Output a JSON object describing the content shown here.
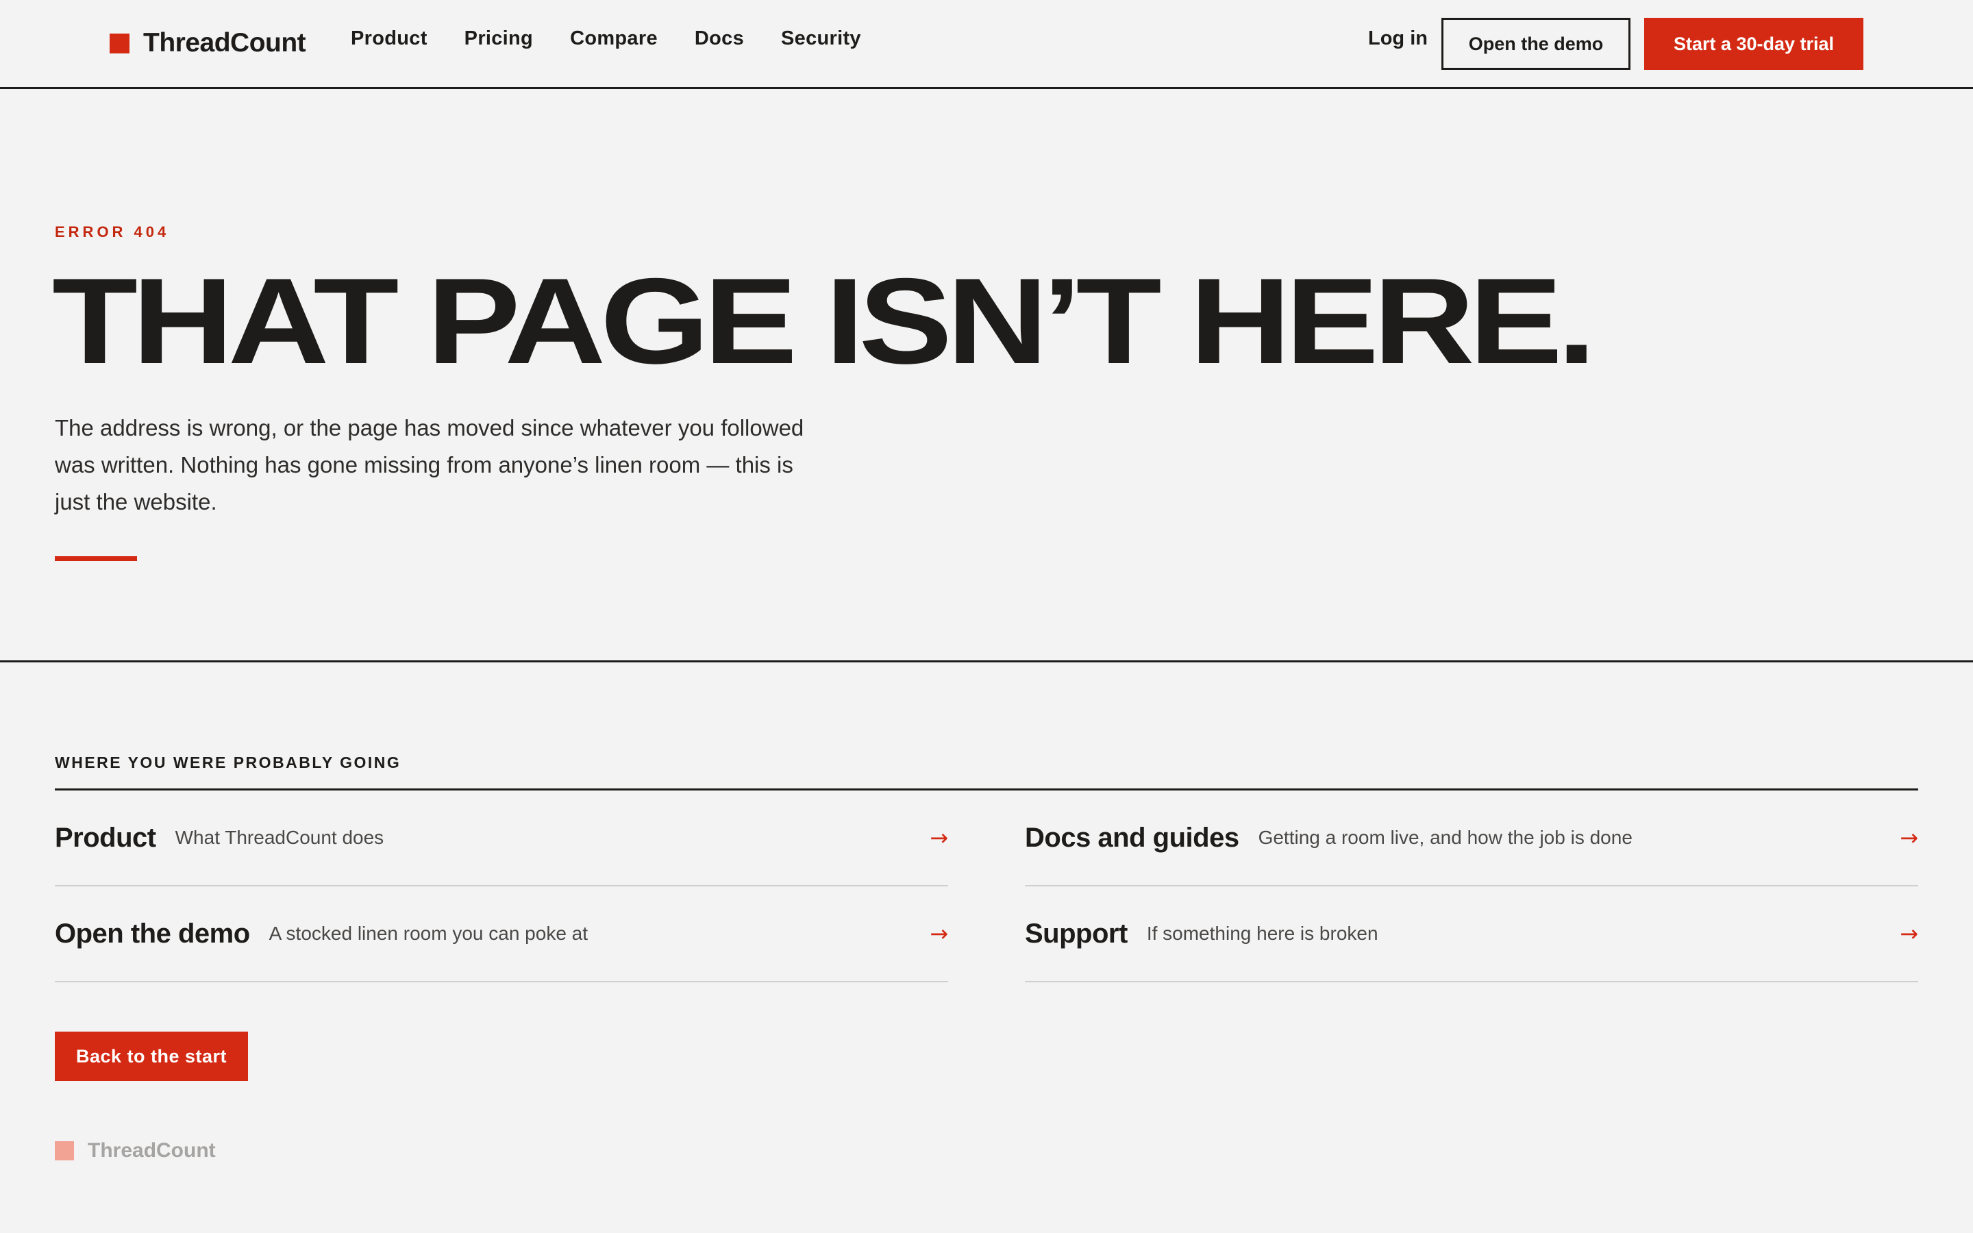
{
  "brand": {
    "name": "ThreadCount",
    "accent_color": "#d42a14"
  },
  "nav": {
    "items": [
      {
        "label": "Product"
      },
      {
        "label": "Pricing"
      },
      {
        "label": "Compare"
      },
      {
        "label": "Docs"
      },
      {
        "label": "Security"
      }
    ],
    "login_label": "Log in",
    "demo_label": "Open the demo",
    "trial_label": "Start a 30-day trial"
  },
  "hero": {
    "eyebrow": "ERROR 404",
    "headline": "THAT PAGE ISN’T HERE.",
    "body": "The address is wrong, or the page has moved since whatever you followed was written. Nothing has gone missing from anyone’s linen room — this is just the website."
  },
  "suggestions": {
    "title": "WHERE YOU WERE PROBABLY GOING",
    "arrow": "→",
    "links": [
      {
        "title": "Product",
        "desc": "What ThreadCount does"
      },
      {
        "title": "Docs and guides",
        "desc": "Getting a room live, and how the job is done"
      },
      {
        "title": "Open the demo",
        "desc": "A stocked linen room you can poke at"
      },
      {
        "title": "Support",
        "desc": "If something here is broken"
      }
    ]
  },
  "back_button_label": "Back to the start",
  "footer": {
    "brand_name": "ThreadCount"
  }
}
